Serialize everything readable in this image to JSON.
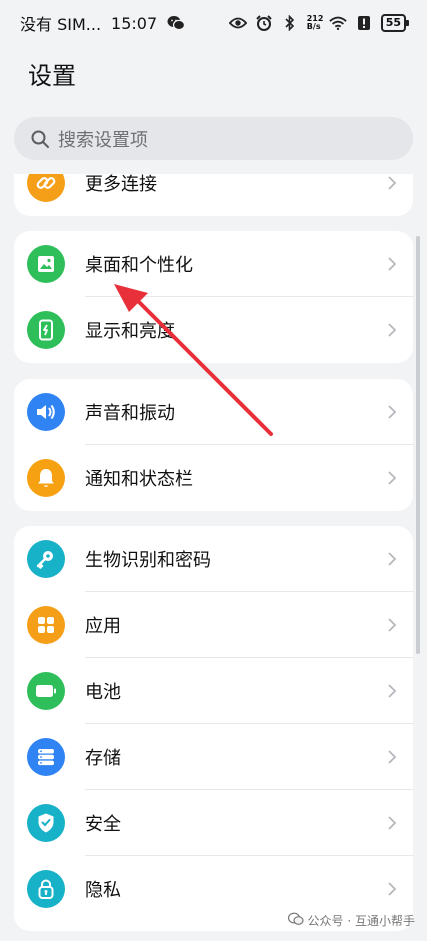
{
  "status_bar": {
    "carrier": "没有 SIM...",
    "time": "15:07",
    "net_speed_top": "212",
    "net_speed_bottom": "B/s",
    "battery": "55",
    "icons": [
      "wechat-icon",
      "eye-icon",
      "alarm-icon",
      "bluetooth-icon",
      "wifi-icon",
      "alert-icon",
      "battery-icon"
    ]
  },
  "header": {
    "title": "设置"
  },
  "search": {
    "placeholder": "搜索设置项"
  },
  "groups": [
    {
      "items": [
        {
          "label": "更多连接",
          "icon": "link-icon",
          "color": "#f59f18"
        }
      ]
    },
    {
      "items": [
        {
          "label": "桌面和个性化",
          "icon": "image-icon",
          "color": "#2fbf5a"
        },
        {
          "label": "显示和亮度",
          "icon": "phone-brightness-icon",
          "color": "#2fbf5a"
        }
      ]
    },
    {
      "items": [
        {
          "label": "声音和振动",
          "icon": "speaker-icon",
          "color": "#2f83f3"
        },
        {
          "label": "通知和状态栏",
          "icon": "bell-icon",
          "color": "#f5a112"
        }
      ]
    },
    {
      "items": [
        {
          "label": "生物识别和密码",
          "icon": "key-icon",
          "color": "#17b1c8"
        },
        {
          "label": "应用",
          "icon": "apps-grid-icon",
          "color": "#f59f18"
        },
        {
          "label": "电池",
          "icon": "battery-icon",
          "color": "#2fbf5a"
        },
        {
          "label": "存储",
          "icon": "storage-icon",
          "color": "#2f83f3"
        },
        {
          "label": "安全",
          "icon": "shield-icon",
          "color": "#17b1c8"
        },
        {
          "label": "隐私",
          "icon": "privacy-lock-icon",
          "color": "#17b1c8"
        }
      ]
    }
  ],
  "watermark": {
    "text": "公众号 · 互通小帮手"
  },
  "annotation": {
    "color": "#e8303a"
  }
}
